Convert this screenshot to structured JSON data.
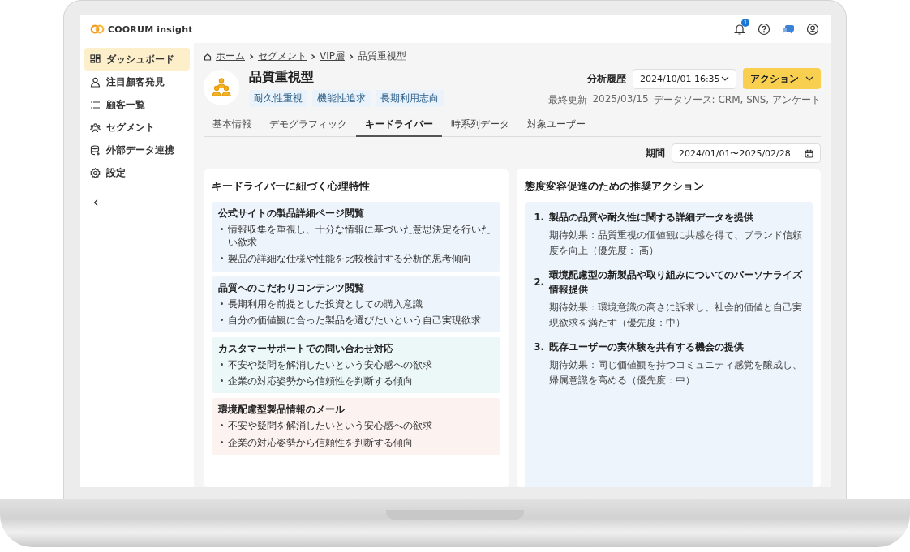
{
  "app": {
    "logo": "COORUM insight"
  },
  "header_icons": [
    {
      "kind": "notifications",
      "badge": "1"
    },
    {
      "kind": "help"
    },
    {
      "kind": "chat"
    },
    {
      "kind": "account"
    }
  ],
  "sidebar": {
    "items": [
      {
        "label": "ダッシュボード",
        "selected": true
      },
      {
        "label": "注目顧客発見",
        "selected": false
      },
      {
        "label": "顧客一覧",
        "selected": false
      },
      {
        "label": "セグメント",
        "selected": false
      },
      {
        "label": "外部データ連携",
        "selected": false
      },
      {
        "label": "設定",
        "selected": false
      }
    ]
  },
  "breadcrumb": [
    {
      "label": "ホーム",
      "link": true
    },
    {
      "label": "セグメント",
      "link": true
    },
    {
      "label": "VIP層",
      "link": true
    },
    {
      "label": "品質重視型",
      "link": false
    }
  ],
  "segment": {
    "title": "品質重視型",
    "tags": [
      "耐久性重視",
      "機能性追求",
      "長期利用志向"
    ]
  },
  "analysis_history": {
    "label": "分析履歴",
    "value": "2024/10/01 16:35"
  },
  "action_button": "アクション",
  "meta": {
    "updated_label": "最終更新",
    "updated": "2025/03/15",
    "source": "データソース: CRM, SNS, アンケート"
  },
  "tabs": [
    {
      "label": "基本情報",
      "selected": false
    },
    {
      "label": "デモグラフィック",
      "selected": false
    },
    {
      "label": "キードライバー",
      "selected": true
    },
    {
      "label": "時系列データ",
      "selected": false
    },
    {
      "label": "対象ユーザー",
      "selected": false
    }
  ],
  "period": {
    "label": "期間",
    "value": "2024/01/01〜2025/02/28"
  },
  "traits": {
    "title": "キードライバーに紐づく心理特性",
    "groups": [
      {
        "title": "公式サイトの製品詳細ページ閲覧",
        "color": "#edf4fb",
        "bullets": [
          "情報収集を重視し、十分な情報に基づいた意思決定を行いたい欲求",
          "製品の詳細な仕様や性能を比較検討する分析的思考傾向"
        ]
      },
      {
        "title": "品質へのこだわりコンテンツ閲覧",
        "color": "#edf4fb",
        "bullets": [
          "長期利用を前提とした投資としての購入意識",
          "自分の価値観に合った製品を選びたいという自己実現欲求"
        ]
      },
      {
        "title": "カスタマーサポートでの問い合わせ対応",
        "color": "#ecf8f8",
        "bullets": [
          "不安や疑問を解消したいという安心感への欲求",
          "企業の対応姿勢から信頼性を判断する傾向"
        ]
      },
      {
        "title": "環境配慮型製品情報のメール",
        "color": "#fcf3f1",
        "bullets": [
          "不安や疑問を解消したいという安心感への欲求",
          "企業の対応姿勢から信頼性を判断する傾向"
        ]
      }
    ]
  },
  "actions": {
    "title": "態度変容促進のための推奨アクション",
    "items": [
      {
        "number": "1.",
        "title": "製品の品質や耐久性に関する詳細データを提供",
        "effect": "期待効果：品質重視の価値観に共感を得て、ブランド信頼度を向上（優先度： 高）"
      },
      {
        "number": "2.",
        "title": "環境配慮型の新製品や取り組みについてのパーソナライズ情報提供",
        "effect": "期待効果：環境意識の高さに訴求し、社会的価値と自己実現欲求を満たす（優先度：中）"
      },
      {
        "number": "3.",
        "title": "既存ユーザーの実体験を共有する機会の提供",
        "effect": "期待効果：同じ価値観を持つコミュニティ感覚を醸成し、帰属意識を高める（優先度：中）"
      }
    ]
  }
}
